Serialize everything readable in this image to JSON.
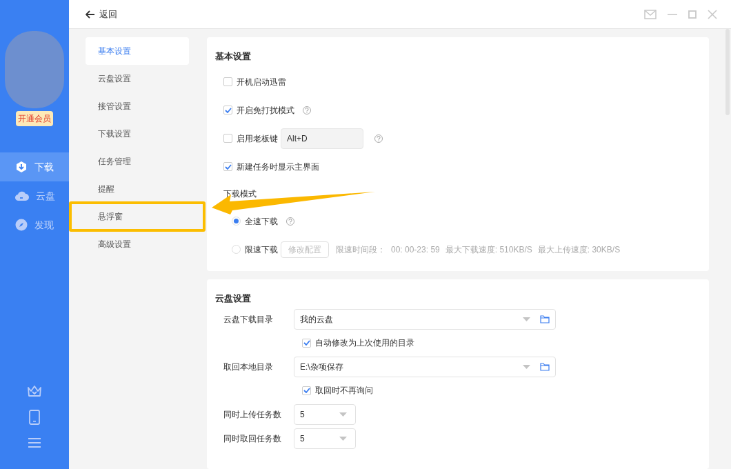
{
  "sidebar": {
    "member_badge": "开通会员",
    "nav": [
      {
        "kind": "download",
        "label": "下载",
        "selected": true
      },
      {
        "kind": "cloud",
        "label": "云盘",
        "selected": false
      },
      {
        "kind": "discover",
        "label": "发现",
        "selected": false
      }
    ]
  },
  "header": {
    "back": "返回"
  },
  "settings_nav": [
    {
      "label": "基本设置",
      "selected": true
    },
    {
      "label": "云盘设置",
      "selected": false
    },
    {
      "label": "接管设置",
      "selected": false
    },
    {
      "label": "下载设置",
      "selected": false
    },
    {
      "label": "任务管理",
      "selected": false
    },
    {
      "label": "提醒",
      "selected": false
    },
    {
      "label": "悬浮窗",
      "selected": false
    },
    {
      "label": "高级设置",
      "selected": false
    }
  ],
  "basic_settings": {
    "title": "基本设置",
    "options": [
      {
        "label": "开机启动迅雷",
        "checked": false,
        "help": false
      },
      {
        "label": "开启免打扰模式",
        "checked": true,
        "help": true
      },
      {
        "label": "启用老板键",
        "checked": false,
        "help": true,
        "shortcut": "Alt+D"
      },
      {
        "label": "新建任务时显示主界面",
        "checked": true,
        "help": false
      }
    ],
    "mode_label": "下载模式",
    "modes": [
      {
        "label": "全速下载",
        "selected": true,
        "help": true
      },
      {
        "label": "限速下载",
        "selected": false,
        "help": false,
        "config_button": "修改配置",
        "info": [
          "限速时间段：",
          "00: 00-23: 59",
          "最大下载速度: 510KB/S",
          "最大上传速度: 30KB/S"
        ]
      }
    ]
  },
  "cloud_settings": {
    "title": "云盘设置",
    "rows": [
      {
        "kind": "select",
        "label": "云盘下载目录",
        "value": "我的云盘",
        "wide": true
      },
      {
        "kind": "checkbox",
        "label": "自动修改为上次使用的目录",
        "checked": true
      },
      {
        "kind": "select",
        "label": "取回本地目录",
        "value": "E:\\杂项保存",
        "wide": true
      },
      {
        "kind": "checkbox",
        "label": "取回时不再询问",
        "checked": true
      },
      {
        "kind": "select",
        "label": "同时上传任务数",
        "value": "5",
        "wide": false
      },
      {
        "kind": "select",
        "label": "同时取回任务数",
        "value": "5",
        "wide": false
      }
    ]
  }
}
